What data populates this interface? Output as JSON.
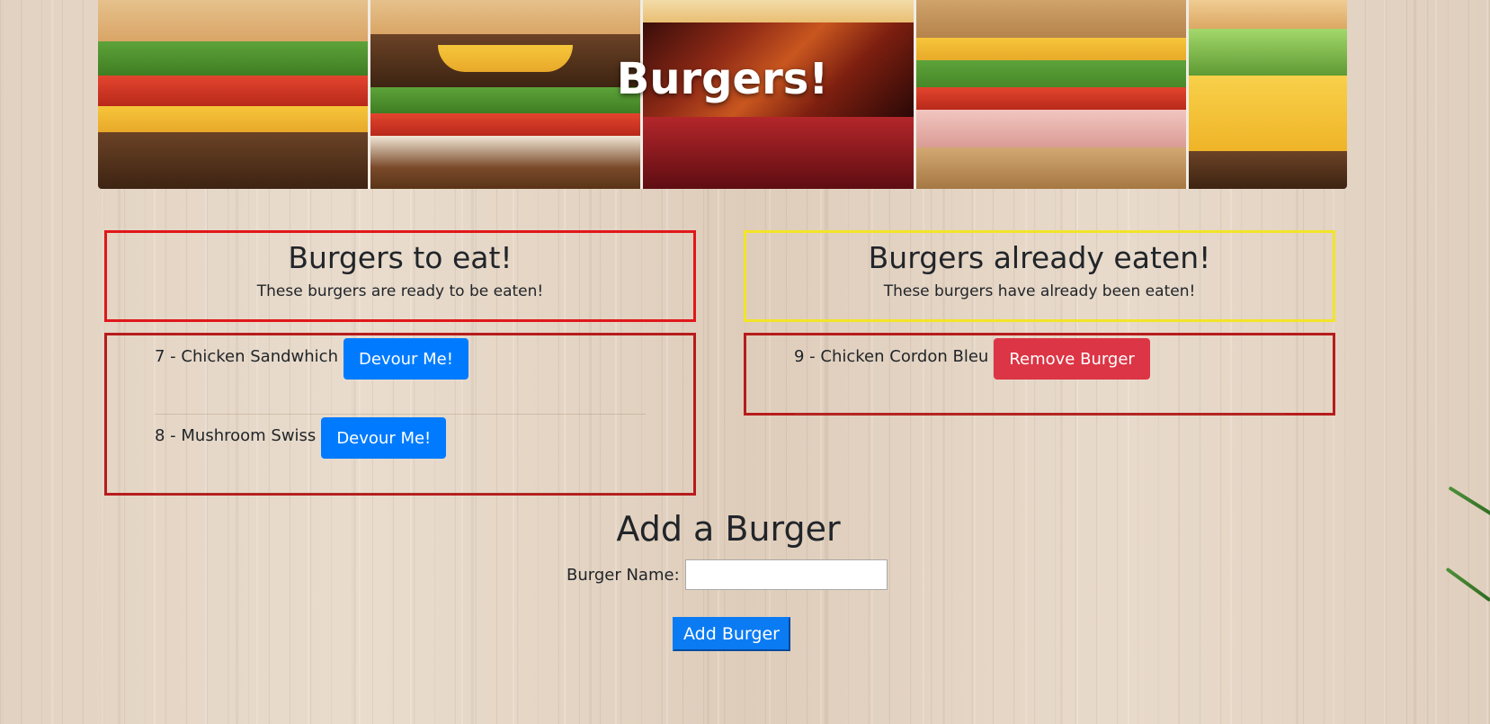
{
  "banner": {
    "title": "Burgers!"
  },
  "left_column": {
    "heading": "Burgers to eat!",
    "subheading": "These burgers are ready to be eaten!",
    "items": [
      {
        "label": "7 - Chicken Sandwhich",
        "button": "Devour Me!"
      },
      {
        "label": "8 - Mushroom Swiss",
        "button": "Devour Me!"
      }
    ]
  },
  "right_column": {
    "heading": "Burgers already eaten!",
    "subheading": "These burgers have already been eaten!",
    "items": [
      {
        "label": "9 - Chicken Cordon Bleu",
        "button": "Remove Burger"
      }
    ]
  },
  "add_form": {
    "title": "Add a Burger",
    "name_label": "Burger Name:",
    "name_value": "",
    "submit_label": "Add Burger"
  },
  "colors": {
    "primary": "#007bff",
    "danger": "#dc3545",
    "to_eat_border": "#e0181a",
    "eaten_border": "#f2e428",
    "list_border": "#b71c1c"
  }
}
